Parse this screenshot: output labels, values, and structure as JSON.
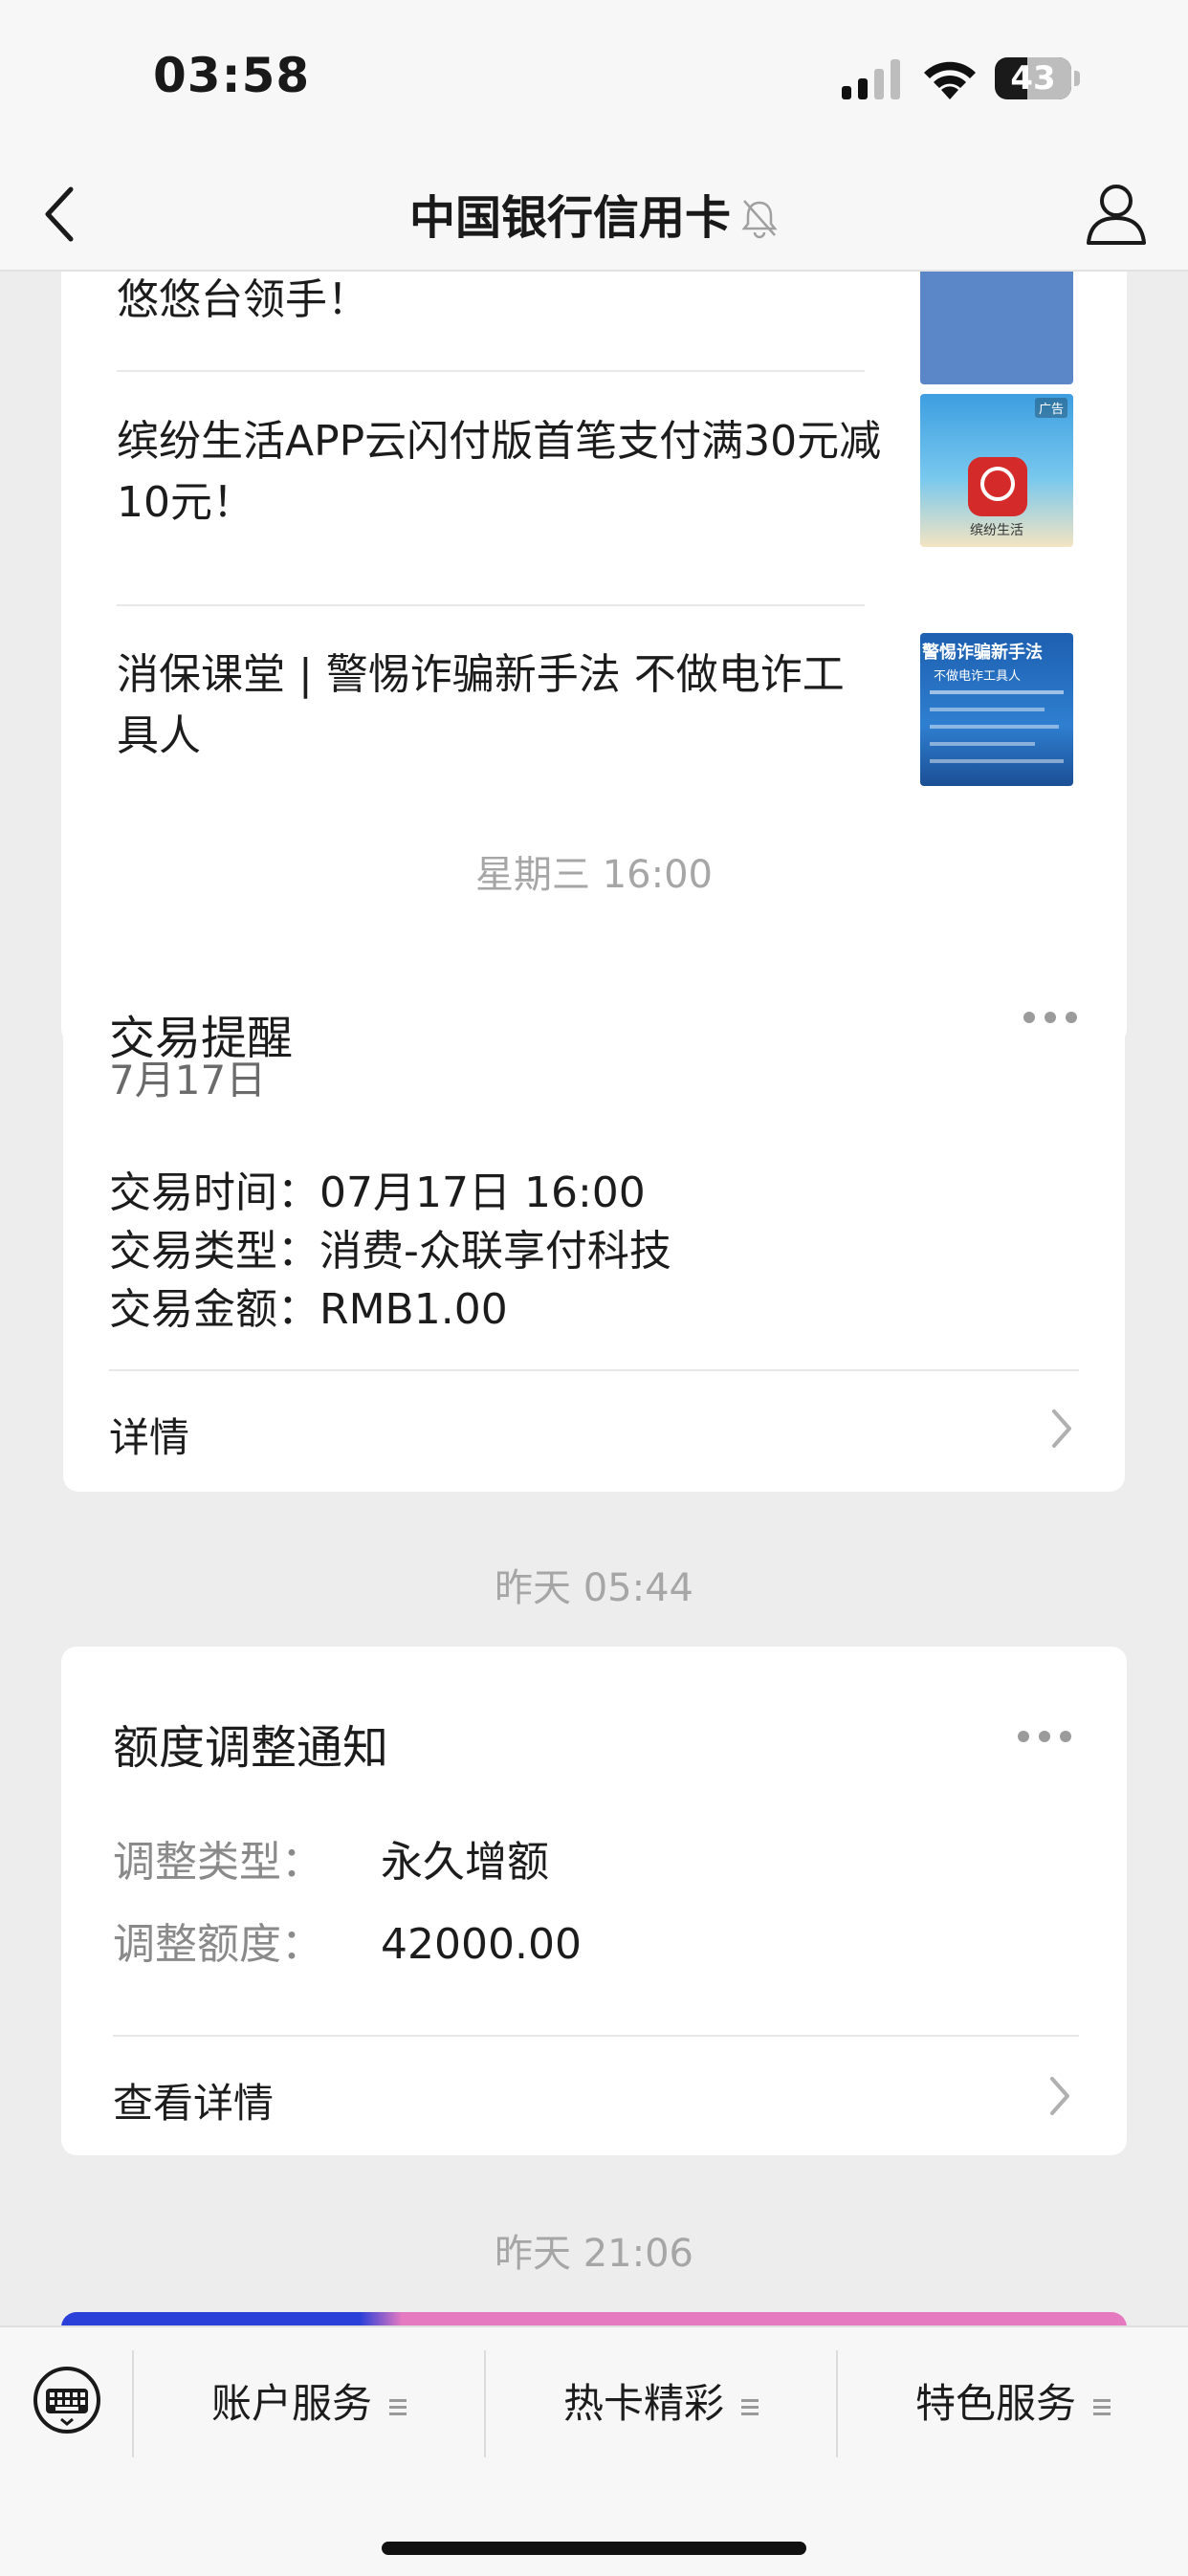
{
  "status_bar": {
    "time": "03:58",
    "battery_level": "43",
    "battery_fraction": 0.43
  },
  "nav": {
    "title": "中国银行信用卡"
  },
  "articles": [
    {
      "title": "悠悠台领手！",
      "thumb_color": "#4a78bf"
    },
    {
      "title": "缤纷生活APP云闪付版首笔支付满30元减10元！",
      "thumb_text": "广告",
      "thumb_caption": "缤纷生活"
    },
    {
      "title": "消保课堂 | 警惕诈骗新手法 不做电诈工具人",
      "thumb_text": "警惕诈骗新手法",
      "thumb_sub": "不做电诈工具人"
    }
  ],
  "ts1": "星期三 16:00",
  "trade": {
    "title": "交易提醒",
    "date": "7月17日",
    "time_label": "交易时间：",
    "time_value": "07月17日 16:00",
    "type_label": "交易类型：",
    "type_value": "消费-众联享付科技",
    "amount_label": "交易金额：",
    "amount_value": "RMB1.00",
    "link": "详情"
  },
  "ts2": "昨天 05:44",
  "limit": {
    "title": "额度调整通知",
    "type_label": "调整类型：",
    "type_value": "永久增额",
    "amount_label": "调整额度：",
    "amount_value": "42000.00",
    "link": "查看详情"
  },
  "ts3": "昨天 21:06",
  "menu": [
    "账户服务",
    "热卡精彩",
    "特色服务"
  ],
  "colors": {
    "background": "#ededed",
    "card": "#ffffff",
    "muted": "#a6a6a6",
    "banner_blue": "#2a40d9",
    "banner_pink": "#e57ac0"
  }
}
